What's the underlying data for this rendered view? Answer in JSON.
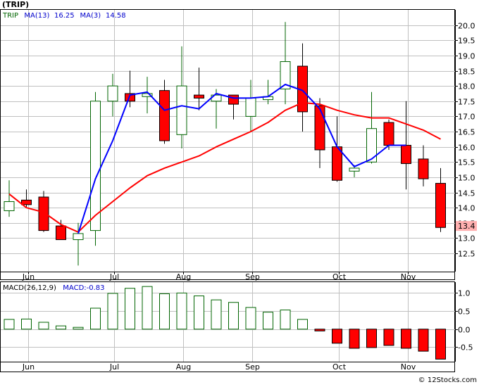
{
  "header": {
    "title": "(TRIP)",
    "legend": [
      {
        "label": "TRIP",
        "color": "#006400"
      },
      {
        "label": "MA(13)",
        "color": "#0000cc"
      },
      {
        "label": "16.25",
        "color": "#0000cc"
      },
      {
        "label": "MA(3)",
        "color": "#0000cc"
      },
      {
        "label": "14.58",
        "color": "#0000cc"
      }
    ]
  },
  "macd_header": {
    "legend": [
      {
        "label": "MACD(26,12,9)",
        "color": "#000000"
      },
      {
        "label": "MACD:-0.83",
        "color": "#0000cc"
      }
    ]
  },
  "watermark": "© 12Stocks.com",
  "colors": {
    "up_candle": "#006400",
    "down_candle": "#ff0000",
    "ma_fast": "#0000ff",
    "ma_slow": "#ff0000",
    "grid": "#c0c0c0",
    "last_price_bg": "#ffb0b0"
  },
  "chart_data": [
    {
      "type": "candlestick",
      "name": "price",
      "grid": true,
      "ylim": [
        11.9,
        20.5
      ],
      "y_ticks": [
        12.5,
        13.0,
        13.5,
        14.0,
        14.5,
        15.0,
        15.5,
        16.0,
        16.5,
        17.0,
        17.5,
        18.0,
        18.5,
        19.0,
        19.5,
        20.0
      ],
      "y_tick_labels": [
        "12.5",
        "13.0",
        "13.5",
        "14.0",
        "14.5",
        "15.0",
        "15.5",
        "16.0",
        "16.5",
        "17.0",
        "17.5",
        "18.0",
        "18.5",
        "19.0",
        "19.5",
        "20.0"
      ],
      "x_months": [
        {
          "label": "Jun",
          "at": 1.1
        },
        {
          "label": "Jul",
          "at": 6.1
        },
        {
          "label": "Aug",
          "at": 10.1
        },
        {
          "label": "Sep",
          "at": 14.1
        },
        {
          "label": "Oct",
          "at": 19.1
        },
        {
          "label": "Nov",
          "at": 23.1
        }
      ],
      "last_price_label": "13.4",
      "last_price": 13.4,
      "candles": [
        {
          "o": 13.9,
          "h": 14.9,
          "l": 13.7,
          "c": 14.2
        },
        {
          "o": 14.25,
          "h": 14.6,
          "l": 14.0,
          "c": 14.1
        },
        {
          "o": 14.35,
          "h": 14.55,
          "l": 13.2,
          "c": 13.25
        },
        {
          "o": 13.4,
          "h": 13.6,
          "l": 12.95,
          "c": 12.95
        },
        {
          "o": 12.95,
          "h": 13.5,
          "l": 12.1,
          "c": 13.15
        },
        {
          "o": 13.25,
          "h": 17.8,
          "l": 12.75,
          "c": 17.5
        },
        {
          "o": 17.5,
          "h": 18.4,
          "l": 17.0,
          "c": 18.0
        },
        {
          "o": 17.75,
          "h": 18.5,
          "l": 17.3,
          "c": 17.5
        },
        {
          "o": 17.65,
          "h": 18.3,
          "l": 17.1,
          "c": 17.75
        },
        {
          "o": 17.85,
          "h": 18.2,
          "l": 16.1,
          "c": 16.2
        },
        {
          "o": 16.4,
          "h": 19.3,
          "l": 15.95,
          "c": 18.0
        },
        {
          "o": 17.7,
          "h": 18.6,
          "l": 17.2,
          "c": 17.6
        },
        {
          "o": 17.5,
          "h": 17.9,
          "l": 16.6,
          "c": 17.7
        },
        {
          "o": 17.7,
          "h": 17.7,
          "l": 16.9,
          "c": 17.4
        },
        {
          "o": 17.0,
          "h": 18.2,
          "l": 16.5,
          "c": 17.6
        },
        {
          "o": 17.55,
          "h": 18.2,
          "l": 17.4,
          "c": 17.65
        },
        {
          "o": 17.9,
          "h": 20.1,
          "l": 17.4,
          "c": 18.8
        },
        {
          "o": 18.65,
          "h": 19.4,
          "l": 16.5,
          "c": 17.15
        },
        {
          "o": 17.35,
          "h": 17.6,
          "l": 15.3,
          "c": 15.9
        },
        {
          "o": 16.0,
          "h": 17.0,
          "l": 14.85,
          "c": 14.9
        },
        {
          "o": 15.2,
          "h": 15.4,
          "l": 15.0,
          "c": 15.3
        },
        {
          "o": 15.5,
          "h": 17.8,
          "l": 15.45,
          "c": 16.6
        },
        {
          "o": 16.8,
          "h": 16.9,
          "l": 15.9,
          "c": 16.05
        },
        {
          "o": 16.05,
          "h": 17.5,
          "l": 14.6,
          "c": 15.45
        },
        {
          "o": 15.6,
          "h": 16.05,
          "l": 14.7,
          "c": 14.95
        },
        {
          "o": 14.8,
          "h": 15.3,
          "l": 13.2,
          "c": 13.35
        }
      ],
      "ma_fast": {
        "name": "MA(3)",
        "points": [
          [
            4,
            13.15
          ],
          [
            5,
            14.95
          ],
          [
            6,
            16.2
          ],
          [
            7,
            17.7
          ],
          [
            8,
            17.8
          ],
          [
            9,
            17.2
          ],
          [
            10,
            17.35
          ],
          [
            11,
            17.25
          ],
          [
            12,
            17.75
          ],
          [
            13,
            17.6
          ],
          [
            14,
            17.6
          ],
          [
            15,
            17.65
          ],
          [
            16,
            18.05
          ],
          [
            17,
            17.85
          ],
          [
            18,
            17.25
          ],
          [
            19,
            16.0
          ],
          [
            20,
            15.35
          ],
          [
            21,
            15.6
          ],
          [
            22,
            16.05
          ],
          [
            23,
            16.05
          ]
        ]
      },
      "ma_slow": {
        "name": "MA(13)",
        "points": [
          [
            0,
            14.45
          ],
          [
            1,
            14.0
          ],
          [
            2,
            13.85
          ],
          [
            3,
            13.45
          ],
          [
            4,
            13.2
          ],
          [
            5,
            13.75
          ],
          [
            6,
            14.2
          ],
          [
            7,
            14.65
          ],
          [
            8,
            15.05
          ],
          [
            9,
            15.3
          ],
          [
            10,
            15.5
          ],
          [
            11,
            15.7
          ],
          [
            12,
            16.0
          ],
          [
            13,
            16.25
          ],
          [
            14,
            16.5
          ],
          [
            15,
            16.8
          ],
          [
            16,
            17.2
          ],
          [
            17,
            17.45
          ],
          [
            18,
            17.4
          ],
          [
            19,
            17.2
          ],
          [
            20,
            17.05
          ],
          [
            21,
            16.95
          ],
          [
            22,
            16.95
          ],
          [
            23,
            16.75
          ],
          [
            24,
            16.55
          ],
          [
            25,
            16.25
          ]
        ]
      }
    },
    {
      "type": "bar",
      "name": "MACD histogram",
      "grid": true,
      "ylim": [
        -0.9,
        1.3
      ],
      "y_ticks": [
        -0.5,
        0.0,
        0.5,
        1.0
      ],
      "y_tick_labels": [
        "-0.5",
        "0.0",
        "0.5",
        "1.0"
      ],
      "x_months": [
        {
          "label": "Jun",
          "at": 1.1
        },
        {
          "label": "Jul",
          "at": 6.1
        },
        {
          "label": "Aug",
          "at": 10.1
        },
        {
          "label": "Sep",
          "at": 14.1
        },
        {
          "label": "Oct",
          "at": 19.1
        },
        {
          "label": "Nov",
          "at": 23.1
        }
      ],
      "values": [
        0.27,
        0.28,
        0.19,
        0.09,
        0.05,
        0.58,
        0.99,
        1.13,
        1.18,
        0.98,
        1.0,
        0.92,
        0.81,
        0.74,
        0.6,
        0.47,
        0.53,
        0.27,
        -0.05,
        -0.39,
        -0.53,
        -0.51,
        -0.45,
        -0.53,
        -0.61,
        -0.83
      ]
    }
  ]
}
